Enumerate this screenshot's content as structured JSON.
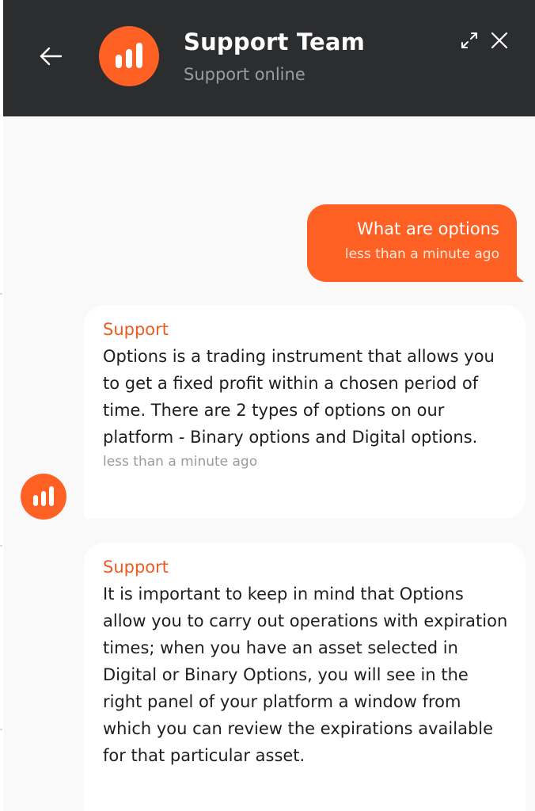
{
  "header": {
    "title": "Support Team",
    "status": "Support online"
  },
  "colors": {
    "header_bg": "#2c2d2f",
    "accent": "#ff6125",
    "sender_label": "#f05a22",
    "chat_bg": "#f9f9f9",
    "bubble_agent": "#ffffff"
  },
  "icons": {
    "back": "arrow-left-icon",
    "avatar": "bar-chart-logo-icon",
    "expand": "expand-icon",
    "close": "close-icon"
  },
  "messages": [
    {
      "from": "user",
      "text": "What are options",
      "time": "less than a minute ago"
    },
    {
      "from": "agent",
      "sender": "Support",
      "text": "Options is a trading instrument that allows you to get a fixed profit within a chosen period of time. There are 2 types of options on our platform - Binary options and Digital options.",
      "time": "less than a minute ago"
    },
    {
      "from": "agent",
      "sender": "Support",
      "text": "It is important to keep in mind that Options allow you to carry out operations with expiration times; when you have an asset selected in Digital or Binary Options, you will see in the right panel of your platform a window from which you can review the expirations available for that particular asset."
    }
  ]
}
